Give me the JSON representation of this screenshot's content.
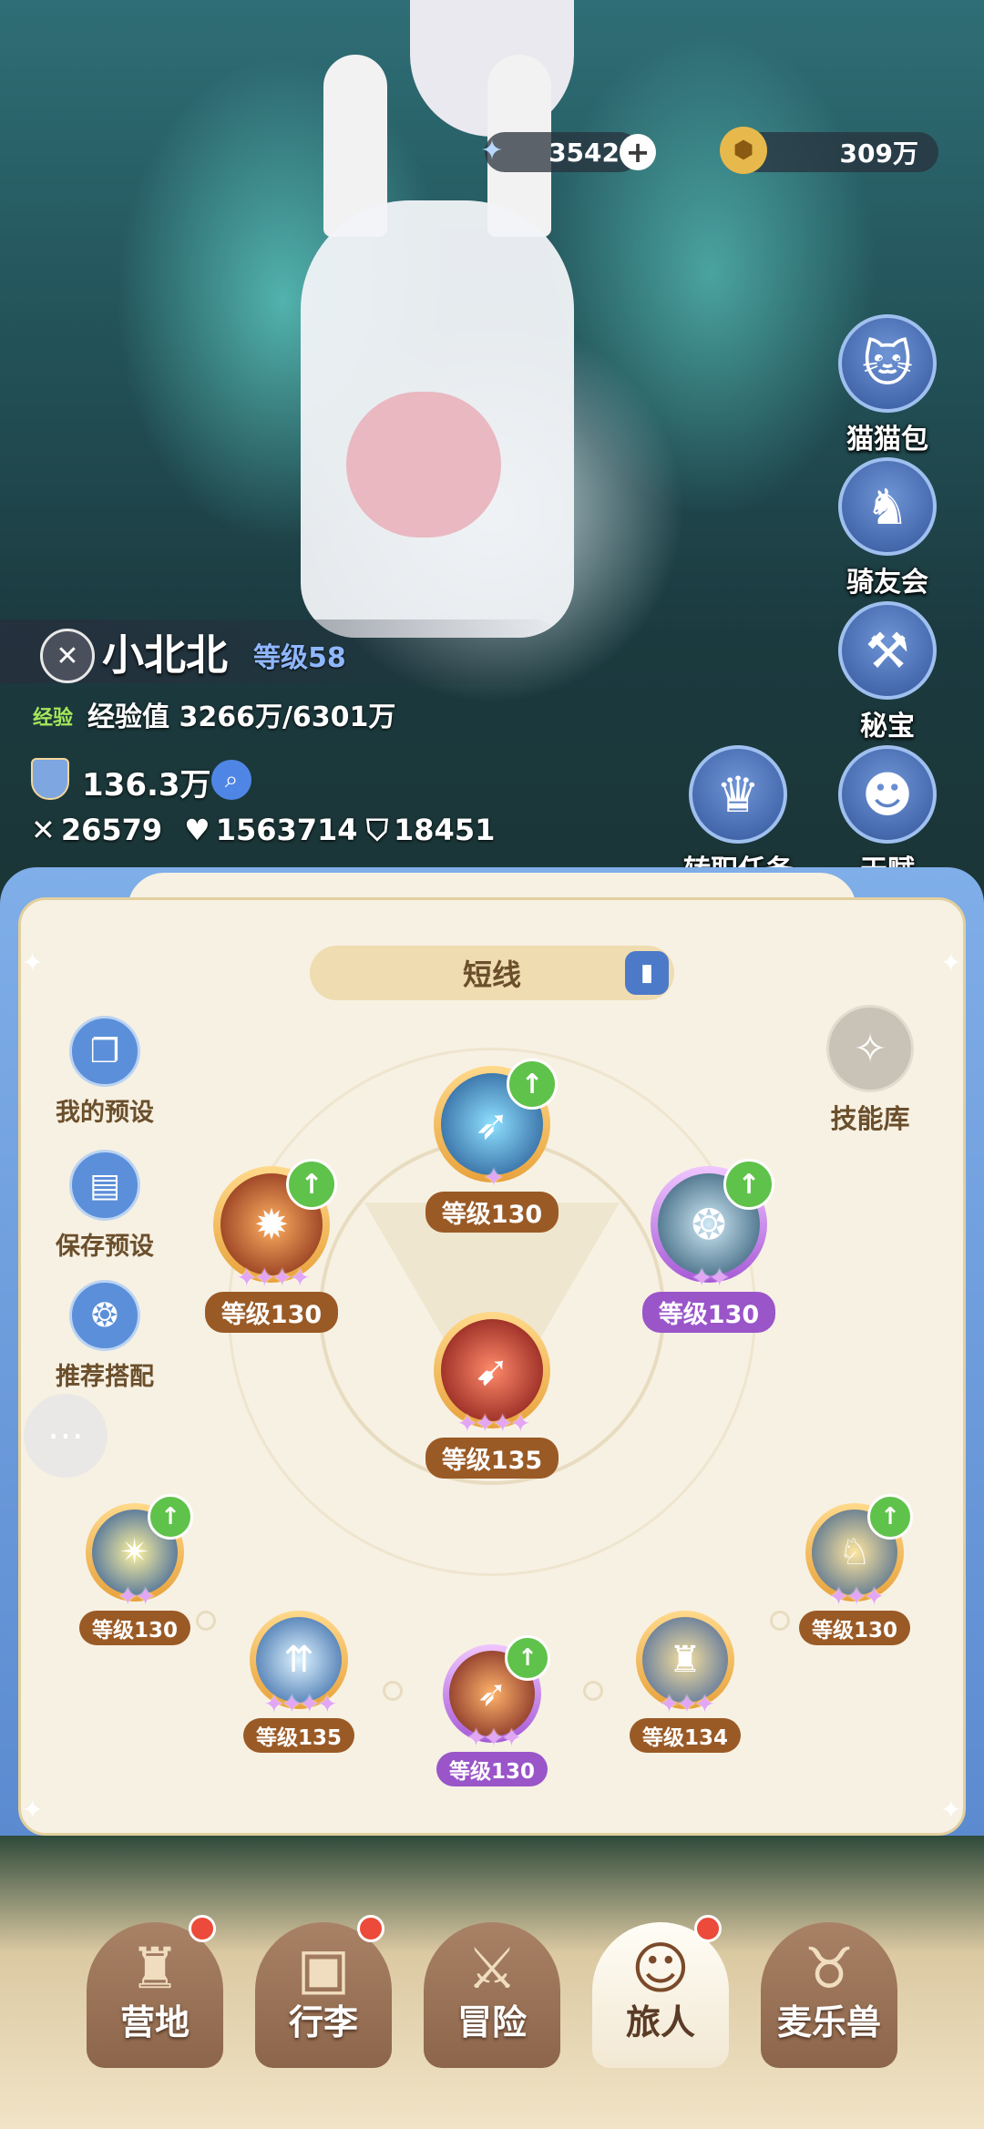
{
  "currencies": {
    "stars": {
      "value": "3542",
      "icon": "star-crystal-icon"
    },
    "gold": {
      "value": "309万",
      "icon": "gold-coin-icon"
    }
  },
  "side_menu": [
    {
      "label": "猫猫包",
      "icon": "cat-bag-icon"
    },
    {
      "label": "骑友会",
      "icon": "horse-head-icon"
    },
    {
      "label": "秘宝",
      "icon": "treasure-chest-icon"
    },
    {
      "label": "天赋",
      "icon": "talent-brain-icon"
    }
  ],
  "job_quest": {
    "label": "转职任务",
    "icon": "crown-icon"
  },
  "player": {
    "name": "小北北",
    "level": "等级58",
    "exp_tag": "经验",
    "exp_text": "经验值 3266万/6301万",
    "power": "136.3万",
    "attack": "26579",
    "hp": "1563714",
    "defense": "18451"
  },
  "skill_panel": {
    "title": "短线",
    "left_buttons": [
      {
        "label": "我的预设",
        "icon": "preset-cards-icon"
      },
      {
        "label": "保存预设",
        "icon": "save-icon"
      },
      {
        "label": "推荐搭配",
        "icon": "recommend-icon"
      }
    ],
    "library": {
      "label": "技能库",
      "icon": "skill-library-icon"
    },
    "skills": [
      {
        "name": "top",
        "level": "等级130"
      },
      {
        "name": "upper-left",
        "level": "等级130"
      },
      {
        "name": "upper-right",
        "level": "等级130"
      },
      {
        "name": "center",
        "level": "等级135"
      },
      {
        "name": "left",
        "level": "等级130"
      },
      {
        "name": "lower-left",
        "level": "等级135"
      },
      {
        "name": "bottom",
        "level": "等级130"
      },
      {
        "name": "lower-right",
        "level": "等级134"
      },
      {
        "name": "right",
        "level": "等级130"
      }
    ]
  },
  "bottom_nav": [
    {
      "label": "营地",
      "icon": "castle-icon",
      "badge": true
    },
    {
      "label": "行李",
      "icon": "backpack-icon",
      "badge": true
    },
    {
      "label": "冒险",
      "icon": "crossed-swords-icon",
      "badge": false
    },
    {
      "label": "旅人",
      "icon": "traveler-avatar-icon",
      "badge": true,
      "active": true
    },
    {
      "label": "麦乐兽",
      "icon": "pet-fox-icon",
      "badge": false
    }
  ]
}
